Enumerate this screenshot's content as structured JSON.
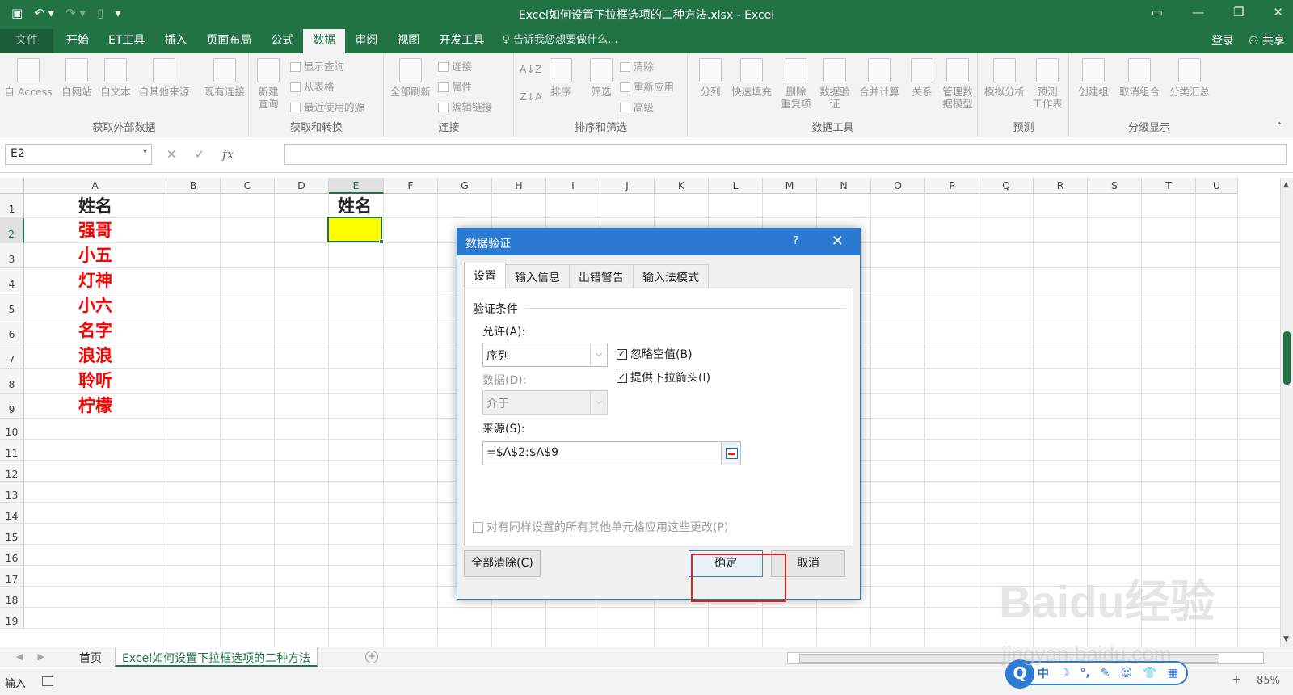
{
  "window": {
    "title": "Excel如何设置下拉框选项的二种方法.xlsx - Excel"
  },
  "ribbon_tabs": [
    "文件",
    "开始",
    "ET工具",
    "插入",
    "页面布局",
    "公式",
    "数据",
    "审阅",
    "视图",
    "开发工具"
  ],
  "active_tab": "数据",
  "tell_me": "告诉我您想要做什么...",
  "account": {
    "login": "登录",
    "share": "共享"
  },
  "ribbon": {
    "groups": {
      "external": "获取外部数据",
      "transform": "获取和转换",
      "connections": "连接",
      "sort_filter": "排序和筛选",
      "data_tools": "数据工具",
      "forecast": "预测",
      "outline": "分级显示"
    },
    "buttons": {
      "access": "自 Access",
      "web": "自网站",
      "text": "自文本",
      "other": "自其他来源",
      "existing": "现有连接",
      "new_query": "新建\n查询",
      "show_query": "显示查询",
      "from_table": "从表格",
      "recent": "最近使用的源",
      "refresh_all": "全部刷新",
      "conn": "连接",
      "props": "属性",
      "edit_links": "编辑链接",
      "sort": "排序",
      "filter": "筛选",
      "clear": "清除",
      "reapply": "重新应用",
      "advanced": "高级",
      "split": "分列",
      "flash": "快速填充",
      "remove_dup": "删除\n重复项",
      "validation": "数据验\n证",
      "consolidate": "合并计算",
      "relations": "关系",
      "manage_model": "管理数\n据模型",
      "whatif": "模拟分析",
      "forecast_sheet": "预测\n工作表",
      "group": "创建组",
      "ungroup": "取消组合",
      "subtotal": "分类汇总"
    }
  },
  "formula_bar": {
    "name_box": "E2",
    "fx": "fx",
    "value": ""
  },
  "columns": [
    "A",
    "B",
    "C",
    "D",
    "E",
    "F",
    "G",
    "H",
    "I",
    "J",
    "K",
    "L",
    "M",
    "N",
    "O",
    "P",
    "Q",
    "R",
    "S",
    "T",
    "U"
  ],
  "rows": [
    "1",
    "2",
    "3",
    "4",
    "5",
    "6",
    "7",
    "8",
    "9",
    "10",
    "11",
    "12",
    "13",
    "14",
    "15",
    "16",
    "17",
    "18",
    "19"
  ],
  "cells": {
    "A1": "姓名",
    "A2": "强哥",
    "A3": "小五",
    "A4": "灯神",
    "A5": "小六",
    "A6": "名字",
    "A7": "浪浪",
    "A8": "聆听",
    "A9": "柠檬",
    "E1": "姓名"
  },
  "colors": {
    "excel_green": "#217346",
    "dialog_blue": "#2b7ad1",
    "name_red": "#ff0000",
    "selected_fill": "#ffff00",
    "highlight_red": "#e02020"
  },
  "sheets": [
    "首页",
    "Excel如何设置下拉框选项的二种方法"
  ],
  "active_sheet": "Excel如何设置下拉框选项的二种方法",
  "status": {
    "mode": "输入",
    "zoom": "85%"
  },
  "ime_bar": [
    "中",
    "☽",
    "°,",
    "✎",
    "☺",
    "👕",
    "▦"
  ],
  "dialog": {
    "title": "数据验证",
    "help": "?",
    "tabs": [
      "设置",
      "输入信息",
      "出错警告",
      "输入法模式"
    ],
    "active_tab": "设置",
    "section": "验证条件",
    "allow_label": "允许(A):",
    "allow_value": "序列",
    "data_label": "数据(D):",
    "data_value": "介于",
    "ignore_blank": "忽略空值(B)",
    "dropdown": "提供下拉箭头(I)",
    "source_label": "来源(S):",
    "source_value": "=$A$2:$A$9",
    "apply_all": "对有同样设置的所有其他单元格应用这些更改(P)",
    "clear_all": "全部清除(C)",
    "ok": "确定",
    "cancel": "取消"
  },
  "watermark": {
    "brand": "Baidu经验",
    "url": "jingyan.baidu.com"
  }
}
